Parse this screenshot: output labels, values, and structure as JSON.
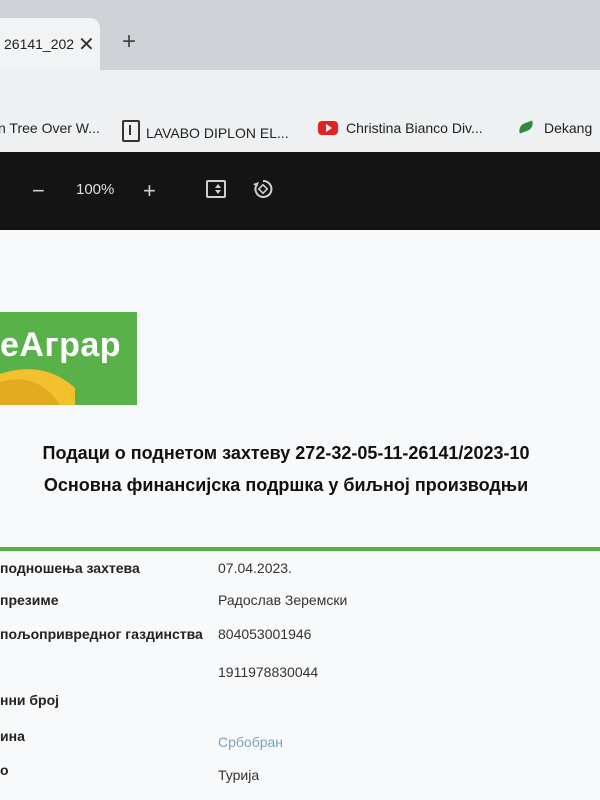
{
  "browser": {
    "tab_title": "26141_202",
    "tab_close_glyph": "✕",
    "new_tab_glyph": "+",
    "bookmarks": [
      {
        "label": "n Tree Over W...",
        "icon": "none"
      },
      {
        "label": "LAVABO DIPLON EL...",
        "icon": "bookmark-page-icon"
      },
      {
        "label": "Christina Bianco Div...",
        "icon": "youtube-icon"
      },
      {
        "label": "Dekang",
        "icon": "leaf-icon"
      }
    ]
  },
  "pdf_toolbar": {
    "zoom_out_glyph": "−",
    "zoom_level": "100%",
    "zoom_in_glyph": "+",
    "fit_icon": "fit-page-icon",
    "rotate_icon": "rotate-icon"
  },
  "document": {
    "logo_text": "eАграр",
    "title_line1": "Подаци о поднетом захтеву 272-32-05-11-26141/2023-10",
    "title_line2": "Основна финансијска подршка у биљној производњи",
    "rows": [
      {
        "label": "подношења захтева",
        "value": "07.04.2023."
      },
      {
        "label": "презиме",
        "value": "Радослав Зеремски"
      },
      {
        "label": "пољопривредног газдинства",
        "value": "804053001946"
      },
      {
        "label": "",
        "value": "1911978830044"
      },
      {
        "label": "нни број",
        "value": ""
      },
      {
        "label": "ина",
        "value": "Србобран"
      },
      {
        "label": "о",
        "value": "Турија"
      }
    ]
  },
  "colors": {
    "brand_green": "#59b14a",
    "logo_yellow": "#f2c12e",
    "toolbar_dark": "#141414"
  }
}
